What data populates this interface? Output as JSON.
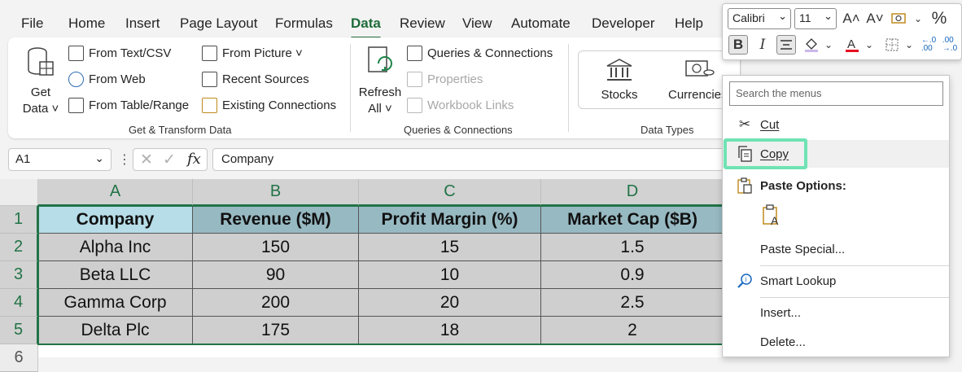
{
  "menu": {
    "tabs": [
      "File",
      "Home",
      "Insert",
      "Page Layout",
      "Formulas",
      "Data",
      "Review",
      "View",
      "Automate",
      "Developer",
      "Help"
    ],
    "active": "Data"
  },
  "ribbon": {
    "get_data": {
      "line1": "Get",
      "line2": "Data ˅"
    },
    "get_transform": {
      "items": [
        "From Text/CSV",
        "From Web",
        "From Table/Range",
        "From Picture ˅",
        "Recent Sources",
        "Existing Connections"
      ],
      "label": "Get & Transform Data"
    },
    "refresh": {
      "line1": "Refresh",
      "line2": "All ˅"
    },
    "queries": {
      "items": [
        "Queries & Connections",
        "Properties",
        "Workbook Links"
      ],
      "label": "Queries & Connections"
    },
    "data_types": {
      "stocks": "Stocks",
      "currencies": "Currencies",
      "label": "Data Types"
    }
  },
  "formula_bar": {
    "name_box": "A1",
    "fx": "fx",
    "content": "Company"
  },
  "grid": {
    "columns": [
      "A",
      "B",
      "C",
      "D"
    ],
    "rows": [
      "1",
      "2",
      "3",
      "4",
      "5",
      "6"
    ],
    "cells": [
      [
        "Company",
        "Revenue ($M)",
        "Profit Margin (%)",
        "Market Cap ($B)"
      ],
      [
        "Alpha Inc",
        "150",
        "15",
        "1.5"
      ],
      [
        "Beta LLC",
        "90",
        "10",
        "0.9"
      ],
      [
        "Gamma Corp",
        "200",
        "20",
        "2.5"
      ],
      [
        "Delta Plc",
        "175",
        "18",
        "2"
      ]
    ]
  },
  "mini_toolbar": {
    "font": "Calibri",
    "size": "11",
    "grow": "A˄",
    "shrink": "A˅",
    "percent": "%",
    "bold": "B",
    "italic": "I"
  },
  "context_menu": {
    "search_placeholder": "Search the menus",
    "cut": "Cut",
    "copy": "Copy",
    "paste_options": "Paste Options:",
    "paste_special": "Paste Special...",
    "smart_lookup": "Smart Lookup",
    "insert": "Insert...",
    "delete": "Delete...",
    "highlight_color": "#6fe3b4"
  },
  "colors": {
    "accent": "#217346",
    "header_fill": "#97b9c2",
    "header_first_fill": "#b6dde8",
    "data_fill": "#cfcfcf"
  }
}
